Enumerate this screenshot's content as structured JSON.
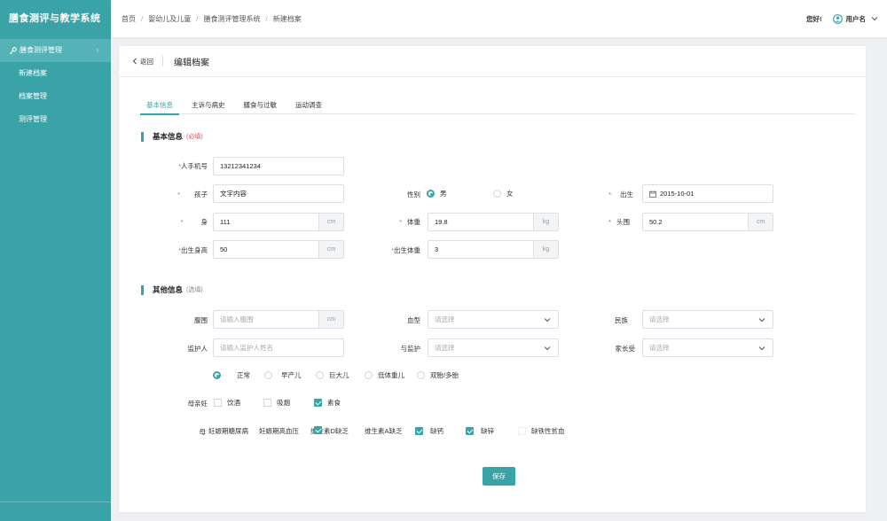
{
  "app": {
    "title": "膳食测评与教学系统"
  },
  "sidebar": {
    "group_label": "膳食测评管理",
    "items": [
      {
        "label": "新建档案"
      },
      {
        "label": "档案管理"
      },
      {
        "label": "测评管理"
      }
    ]
  },
  "breadcrumb": [
    "首页",
    "婴幼儿及儿童",
    "膳食测评管理系统",
    "新建档案"
  ],
  "header": {
    "greeting": "您好!",
    "username": "用户名"
  },
  "card": {
    "back_label": "返回",
    "title": "编辑档案"
  },
  "tabs": [
    {
      "label": "基本信息",
      "active": true
    },
    {
      "label": "主诉与病史",
      "active": false
    },
    {
      "label": "膳食与过敏",
      "active": false
    },
    {
      "label": "运动调查",
      "active": false
    }
  ],
  "basic": {
    "title": "基本信息",
    "note": "(必填)",
    "phone": {
      "label": "人手机号",
      "value": "13212341234"
    },
    "child": {
      "label": "孩子",
      "value": "文字内容"
    },
    "gender": {
      "label": "性别",
      "male": "男",
      "female": "女",
      "selected": "男"
    },
    "birth": {
      "label": "出生",
      "value": "2015-10-01"
    },
    "height": {
      "label": "身",
      "value": "111",
      "unit": "cm"
    },
    "weight": {
      "label": "体重",
      "value": "19.8",
      "unit": "kg"
    },
    "head": {
      "label": "头围",
      "value": "50.2",
      "unit": "cm"
    },
    "birth_height": {
      "label": "出生身高",
      "value": "50",
      "unit": "cm"
    },
    "birth_weight": {
      "label": "出生体重",
      "value": "3",
      "unit": "kg"
    }
  },
  "other": {
    "title": "其他信息",
    "note": "(选填)",
    "waist": {
      "label": "腹围",
      "placeholder": "请输入腹围",
      "unit": "cm"
    },
    "blood": {
      "label": "血型",
      "placeholder": "请选择"
    },
    "ethnic": {
      "label": "民族",
      "placeholder": "请选择"
    },
    "guardian": {
      "label": "监护人",
      "placeholder": "请输入监护人姓名"
    },
    "relation": {
      "label": "与监护",
      "placeholder": "请选择"
    },
    "parent_love": {
      "label": "家长受",
      "placeholder": "请选择"
    },
    "birth_types": {
      "options": [
        "正常",
        "早产儿",
        "巨大儿",
        "低体重儿",
        "双胎/多胎"
      ],
      "selected": "正常"
    },
    "mother_preg": {
      "label": "母亲妊",
      "options": [
        {
          "label": "饮酒",
          "checked": false
        },
        {
          "label": "吸烟",
          "checked": false
        },
        {
          "label": "素食",
          "checked": true
        }
      ]
    },
    "mother_disease": {
      "label": "母",
      "items": [
        {
          "label": "妊娠期糖尿病",
          "checked": false
        },
        {
          "label": "妊娠期高血压",
          "checked": false
        },
        {
          "label": "维生素D缺乏",
          "checked": true
        },
        {
          "label": "维生素A缺乏",
          "checked": false
        },
        {
          "label": "缺钙",
          "checked": true
        },
        {
          "label": "缺锌",
          "checked": true
        },
        {
          "label": "缺铁性贫血",
          "checked": false
        }
      ]
    }
  },
  "save_label": "保存",
  "colors": {
    "accent": "#3aa3a8",
    "required": "#e0505a"
  }
}
